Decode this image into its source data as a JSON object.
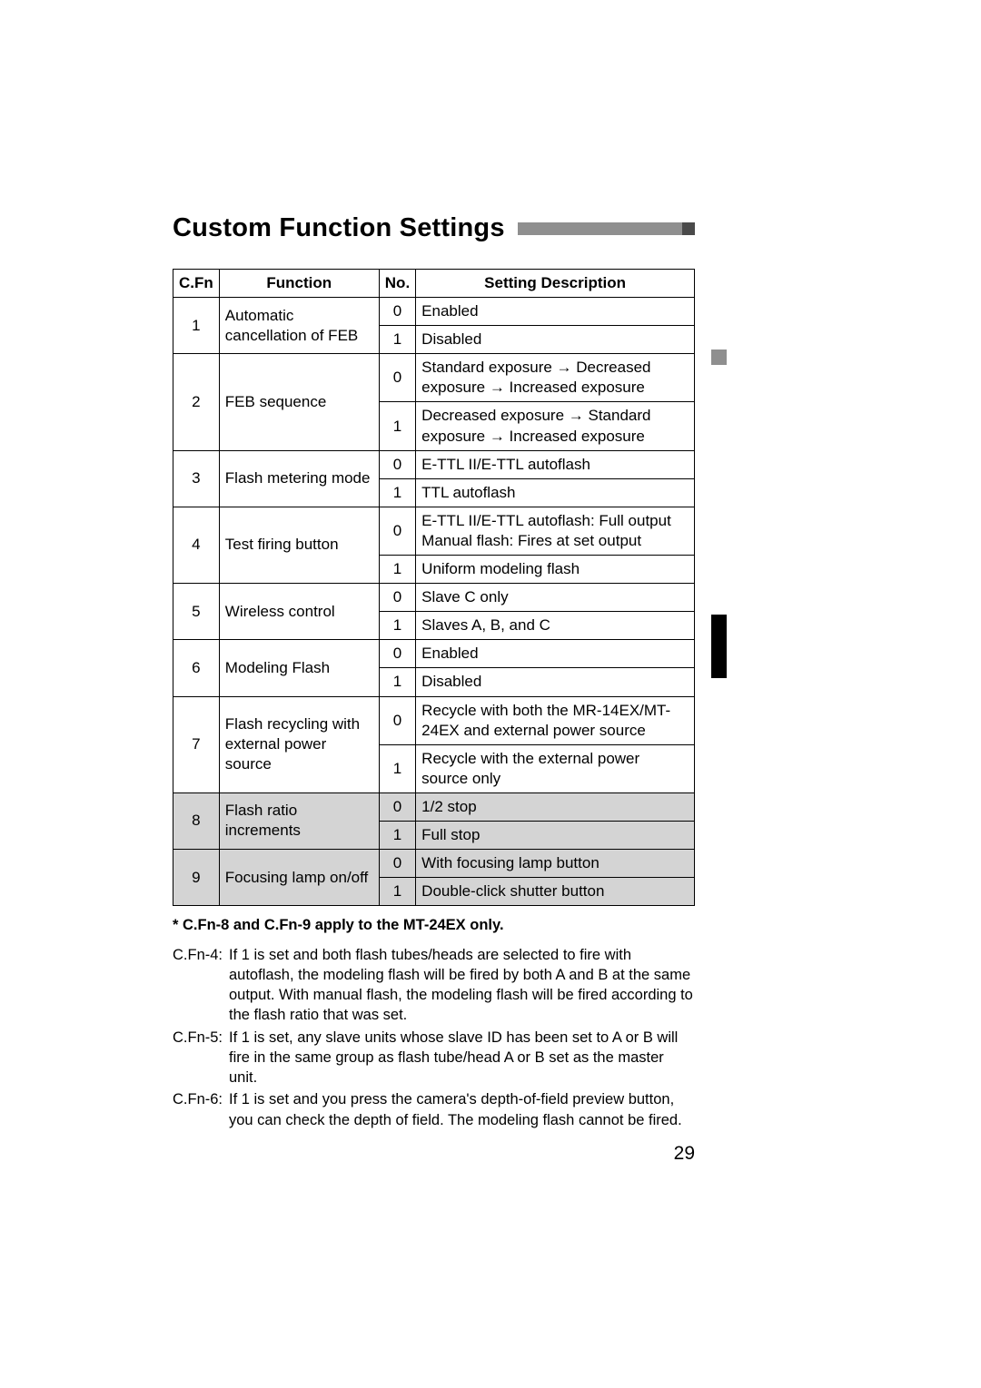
{
  "title": "Custom Function Settings",
  "page_number": "29",
  "table": {
    "headers": {
      "cfn": "C.Fn",
      "func": "Function",
      "no": "No.",
      "desc": "Setting Description"
    },
    "rows": [
      {
        "cfn": "1",
        "func": "Automatic cancellation of FEB",
        "settings": [
          {
            "no": "0",
            "desc": "Enabled"
          },
          {
            "no": "1",
            "desc": "Disabled"
          }
        ]
      },
      {
        "cfn": "2",
        "func": "FEB sequence",
        "settings": [
          {
            "no": "0",
            "desc": "Standard exposure → Decreased exposure → Increased exposure"
          },
          {
            "no": "1",
            "desc": "Decreased exposure → Standard exposure → Increased exposure"
          }
        ]
      },
      {
        "cfn": "3",
        "func": "Flash metering mode",
        "settings": [
          {
            "no": "0",
            "desc": "E-TTL II/E-TTL autoflash"
          },
          {
            "no": "1",
            "desc": "TTL autoflash"
          }
        ]
      },
      {
        "cfn": "4",
        "func": "Test firing button",
        "settings": [
          {
            "no": "0",
            "desc": "E-TTL II/E-TTL autoflash: Full output Manual flash: Fires at set output"
          },
          {
            "no": "1",
            "desc": "Uniform modeling flash"
          }
        ]
      },
      {
        "cfn": "5",
        "func": "Wireless control",
        "settings": [
          {
            "no": "0",
            "desc": "Slave C only"
          },
          {
            "no": "1",
            "desc": "Slaves A, B, and C"
          }
        ]
      },
      {
        "cfn": "6",
        "func": "Modeling Flash",
        "settings": [
          {
            "no": "0",
            "desc": "Enabled"
          },
          {
            "no": "1",
            "desc": "Disabled"
          }
        ]
      },
      {
        "cfn": "7",
        "func": "Flash recycling with external power source",
        "settings": [
          {
            "no": "0",
            "desc": "Recycle with both the MR-14EX/MT-24EX and external power source"
          },
          {
            "no": "1",
            "desc": "Recycle with the external power source only"
          }
        ]
      },
      {
        "cfn": "8",
        "func": "Flash ratio increments",
        "shaded": true,
        "settings": [
          {
            "no": "0",
            "desc": "1/2 stop"
          },
          {
            "no": "1",
            "desc": "Full stop"
          }
        ]
      },
      {
        "cfn": "9",
        "func": "Focusing lamp on/off",
        "shaded": true,
        "settings": [
          {
            "no": "0",
            "desc": "With focusing lamp button"
          },
          {
            "no": "1",
            "desc": "Double-click shutter button"
          }
        ]
      }
    ]
  },
  "footnote_star": "* C.Fn-8 and C.Fn-9 apply to the MT-24EX only.",
  "footnotes": [
    {
      "label": "C.Fn-4:",
      "text": "If 1 is set and both flash tubes/heads are selected to fire with autoflash, the modeling flash will be fired by both A and B at the same output. With manual flash, the modeling flash will be fired according to the flash ratio that was set."
    },
    {
      "label": "C.Fn-5:",
      "text": "If 1 is set, any slave units whose slave ID has been set to A or B will fire in the same group as flash tube/head A or B set as the master unit."
    },
    {
      "label": "C.Fn-6:",
      "text": "If 1 is set and you press the camera's depth-of-field preview button, you can check the depth of field. The modeling flash cannot be fired."
    }
  ]
}
